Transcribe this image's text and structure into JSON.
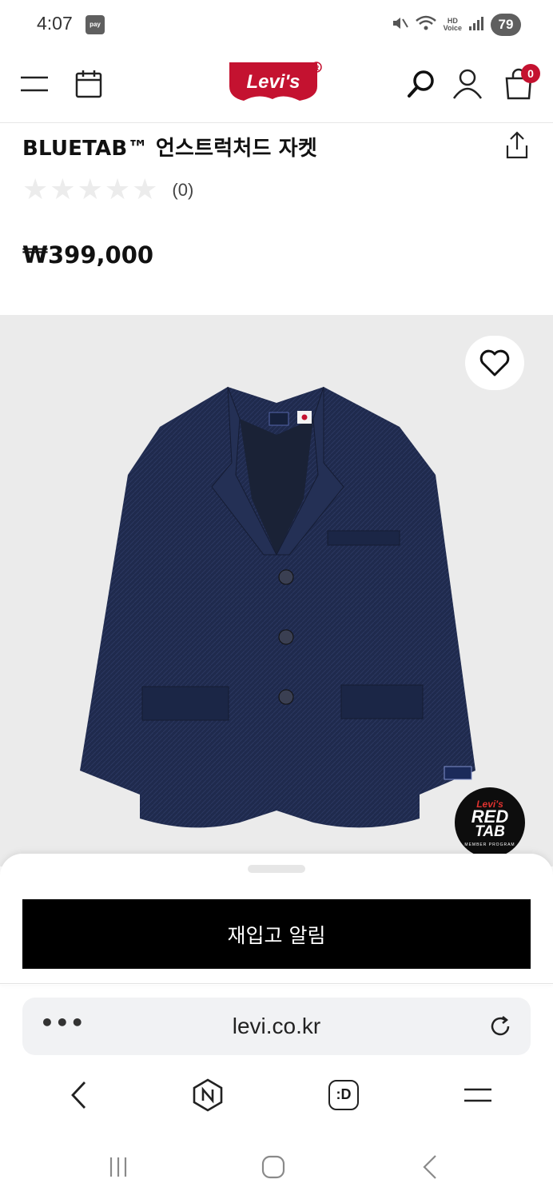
{
  "status_bar": {
    "time": "4:07",
    "pay_label": "pay",
    "hd_label_top": "HD",
    "hd_label_bottom": "Voice",
    "battery": "79"
  },
  "header": {
    "brand": "Levi's",
    "cart_count": "0"
  },
  "product": {
    "title": "BLUETAB™ 언스트럭처드 자켓",
    "review_count": "(0)",
    "rating_stars": 0,
    "rating_max": 5,
    "price": "₩399,000"
  },
  "badge": {
    "line1": "Levi's",
    "line2": "RED",
    "line3": "TAB",
    "line4": "MEMBER PROGRAM"
  },
  "cta": {
    "restock_label": "재입고 알림"
  },
  "browser": {
    "url": "levi.co.kr",
    "more_label": "•••"
  },
  "colors": {
    "brand_red": "#c41230",
    "jacket_navy": "#1f2a4d",
    "cta_black": "#000000",
    "image_bg": "#ebebeb"
  }
}
